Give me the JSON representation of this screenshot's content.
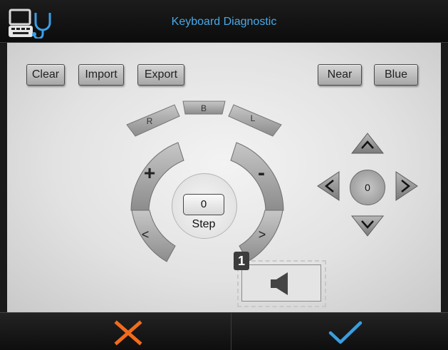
{
  "titlebar": {
    "title": "Keyboard Diagnostic",
    "icon": "keyboard-stethoscope-icon"
  },
  "toolbar": {
    "clear_label": "Clear",
    "import_label": "Import",
    "export_label": "Export",
    "near_label": "Near",
    "blue_label": "Blue"
  },
  "dial": {
    "top_buttons": [
      "R",
      "B",
      "L"
    ],
    "plus_label": "+",
    "minus_label": "-",
    "prev_label": "<",
    "next_label": ">",
    "step_value": "0",
    "step_label": "Step"
  },
  "dpad": {
    "center_value": "0"
  },
  "speaker": {
    "badge": "1",
    "icon": "speaker-icon"
  },
  "footer": {
    "cancel_icon": "close-icon",
    "confirm_icon": "checkmark-icon"
  },
  "colors": {
    "accent_blue": "#4aa9e6",
    "cancel_orange": "#f26b1d",
    "confirm_blue": "#3a9ee0"
  }
}
